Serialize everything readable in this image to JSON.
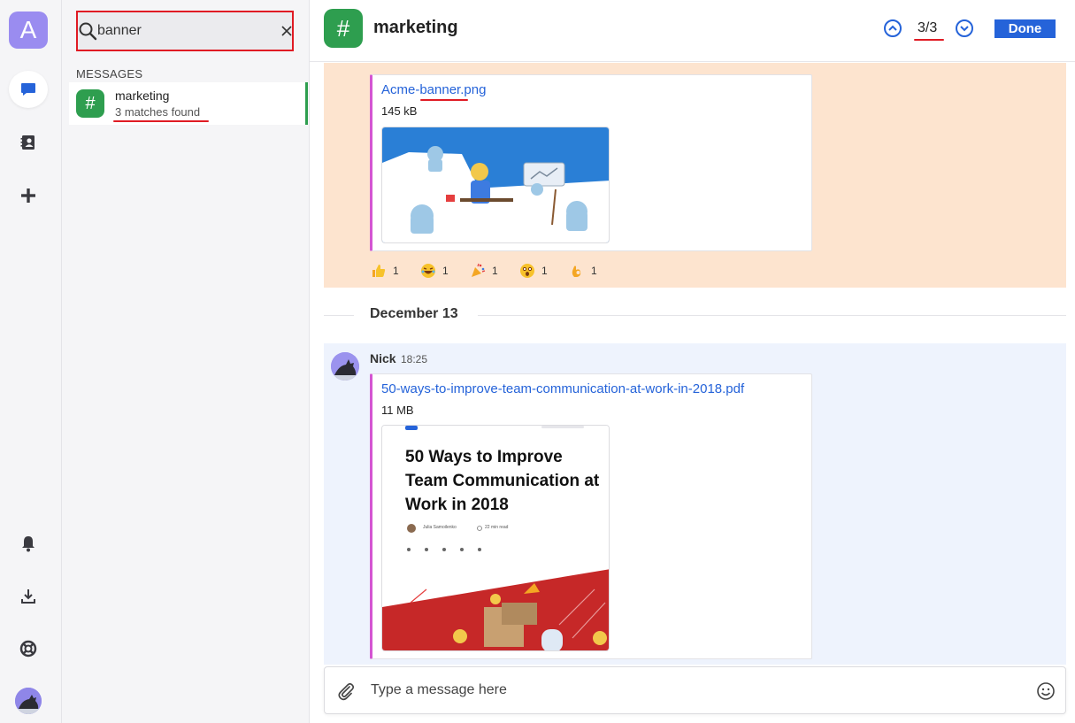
{
  "workspace": {
    "initial": "A",
    "accent": "#9a8cf0"
  },
  "search": {
    "value": "banner",
    "placeholder": "Search"
  },
  "results": {
    "section_label": "MESSAGES",
    "items": [
      {
        "name": "marketing",
        "subtitle": "3 matches found"
      }
    ]
  },
  "channel": {
    "name": "marketing",
    "color": "#2e9e4f"
  },
  "navigation": {
    "counter": "3/3",
    "done_label": "Done"
  },
  "messages": [
    {
      "file_name_prefix": "Acme-",
      "file_name_match": "banner",
      "file_name_suffix": ".png",
      "file_size": "145 kB",
      "reactions": [
        {
          "icon": "thumbs-up-icon",
          "count": "1"
        },
        {
          "icon": "laughing-icon",
          "count": "1"
        },
        {
          "icon": "party-popper-icon",
          "count": "1"
        },
        {
          "icon": "astonished-icon",
          "count": "1"
        },
        {
          "icon": "ok-hand-icon",
          "count": "1"
        }
      ]
    },
    {
      "author": "Nick",
      "time": "18:25",
      "file_name": "50-ways-to-improve-team-communication-at-work-in-2018.pdf",
      "file_size": "11 MB",
      "preview_title": "50 Ways to Improve Team Communication at Work in 2018",
      "preview_author": "Julia Samoilenko",
      "preview_read_time": "22 min read"
    }
  ],
  "date_separator": "December 13",
  "composer": {
    "placeholder": "Type a message here"
  },
  "colors": {
    "link": "#2563d9",
    "highlight": "#fde4cf",
    "selected_message_bg": "#eef3fd",
    "search_outline": "#e01b24",
    "card_accent": "#d455d2"
  }
}
